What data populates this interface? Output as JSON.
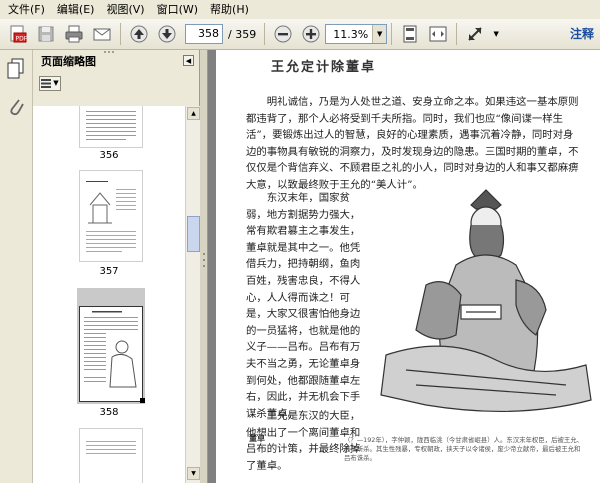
{
  "menubar": {
    "items": [
      "文件(F)",
      "编辑(E)",
      "视图(V)",
      "窗口(W)",
      "帮助(H)"
    ]
  },
  "toolbar": {
    "current_page": "358",
    "page_total": "/ 359",
    "zoom": "11.3%",
    "right_text": "注释"
  },
  "panel": {
    "title": "页面缩略图"
  },
  "thumbnails": [
    {
      "label": "356"
    },
    {
      "label": "357"
    },
    {
      "label": "358"
    }
  ],
  "document": {
    "title": "王允定计除董卓",
    "paragraph1": "明礼诚信，乃是为人处世之道、安身立命之本。如果违这一基本原则都违背了，那个人必将受到千夫所指。同时，我们也应“像间谍一样生活”，要锻炼出过人的智慧，良好的心理素质，遇事沉着冷静，同时对身边的事物具有敏锐的洞察力，及时发现身边的隐患。三国时期的董卓，不仅仅是个背信弃义、不顾君臣之礼的小人，同时对身边的人和事又都麻痹大意，以致最终败于王允的“美人计”。",
    "paragraph2": "东汉末年，国家贫弱，地方割据势力强大，常有欺君篡主之事发生，董卓就是其中之一。他凭借兵力，把持朝纲，鱼肉百姓，残害忠良，不得人心，人人得而诛之！可是，大家又很害怕他身边的一员猛将，也就是他的义子——吕布。吕布有万夫不当之勇，无论董卓身到何处，他都跟随董卓左右，因此，并无机会下手谋杀董卓。",
    "paragraph3": "王允是东汉的大臣，他想出了一个离间董卓和吕布的计策，并最终除掉了董卓。",
    "caption_title": "董卓",
    "caption_text": "（？—192年），字仲颖，陇西临洮（今甘肃省岷县）人。东汉末年权臣，后被王允、吕布所杀。其生性残暴，专权朝政，挟天子以令诸侯，废少帝立献帝，最后被王允和吕布诛杀。"
  },
  "colors": {
    "accent": "#1a4fa0",
    "chrome": "#ece9d8",
    "doc_background": "#808080"
  }
}
